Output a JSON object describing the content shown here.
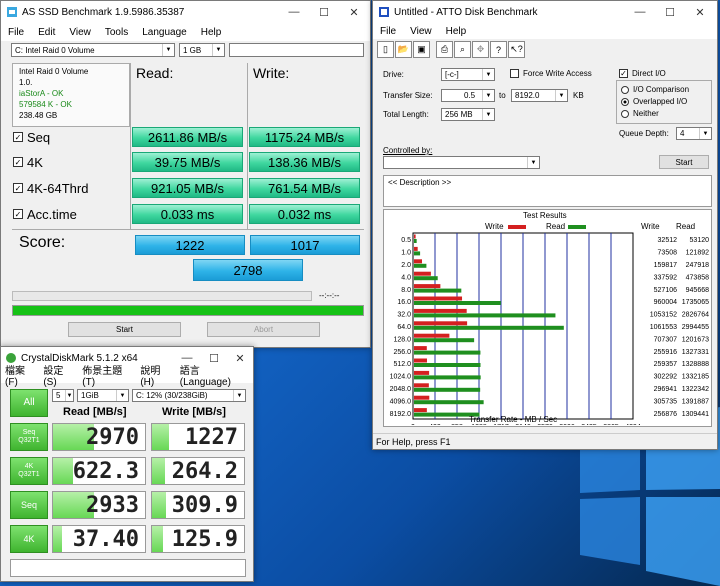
{
  "asssd": {
    "title": "AS SSD Benchmark 1.9.5986.35387",
    "menu": [
      "File",
      "Edit",
      "View",
      "Tools",
      "Language",
      "Help"
    ],
    "drive": "C: Intel Raid 0 Volume",
    "size": "1 GB",
    "info": {
      "name": "Intel Raid 0 Volume",
      "ver": "1.0.",
      "driver": "iaStorA - OK",
      "align": "579584 K - OK",
      "cap": "238.48 GB"
    },
    "read_hdr": "Read:",
    "write_hdr": "Write:",
    "rows": [
      {
        "label": "Seq",
        "read": "2611.86 MB/s",
        "write": "1175.24 MB/s"
      },
      {
        "label": "4K",
        "read": "39.75 MB/s",
        "write": "138.36 MB/s"
      },
      {
        "label": "4K-64Thrd",
        "read": "921.05 MB/s",
        "write": "761.54 MB/s"
      },
      {
        "label": "Acc.time",
        "read": "0.033 ms",
        "write": "0.032 ms"
      }
    ],
    "score_label": "Score:",
    "score_read": "1222",
    "score_write": "1017",
    "score_total": "2798",
    "time": "--:--:--",
    "start": "Start",
    "abort": "Abort",
    "progress": 1.0
  },
  "atto": {
    "title": "Untitled - ATTO Disk Benchmark",
    "menu": [
      "File",
      "View",
      "Help"
    ],
    "drive_label": "Drive:",
    "drive": "[-c-]",
    "force_write": "Force Write Access",
    "direct_io": "Direct I/O",
    "transfer_label": "Transfer Size:",
    "ts_from": "0.5",
    "ts_to_label": "to",
    "ts_to": "8192.0",
    "ts_unit": "KB",
    "total_label": "Total Length:",
    "total": "256 MB",
    "io_comparison": "I/O Comparison",
    "overlapped": "Overlapped I/O",
    "neither": "Neither",
    "queue_label": "Queue Depth:",
    "queue": "4",
    "controlled_label": "Controlled by:",
    "start": "Start",
    "description": "<< Description >>",
    "status": "For Help, press F1",
    "toolbar_icons": [
      "new-icon",
      "open-icon",
      "save-icon",
      "print-icon",
      "print-preview-icon",
      "move-icon",
      "help-icon",
      "context-help-icon"
    ]
  },
  "chart_data": {
    "type": "bar",
    "title": "Test Results",
    "legend": [
      "Write",
      "Read"
    ],
    "xlabel": "Transfer Rate - MB / Sec",
    "xticks": [
      "0",
      "429",
      "858",
      "1288",
      "1717",
      "2146",
      "2576",
      "3006",
      "3435",
      "3865",
      "4294"
    ],
    "xlim": [
      0,
      4294
    ],
    "categories": [
      "0.5",
      "1.0",
      "2.0",
      "4.0",
      "8.0",
      "16.0",
      "32.0",
      "64.0",
      "128.0",
      "256.0",
      "512.0",
      "1024.0",
      "2048.0",
      "4096.0",
      "8192.0"
    ],
    "col_write": "Write",
    "col_read": "Read",
    "series": [
      {
        "name": "Write",
        "color": "#d42020",
        "values": [
          32512,
          73508,
          159817,
          337592,
          527106,
          960004,
          1053152,
          1061553,
          707307,
          255916,
          259357,
          302292,
          296941,
          305735,
          256876
        ]
      },
      {
        "name": "Read",
        "color": "#1f8f1f",
        "values": [
          53120,
          121892,
          247918,
          473858,
          945668,
          1735065,
          2826764,
          2994455,
          1201673,
          1327331,
          1328888,
          1332185,
          1322342,
          1391887,
          1309441
        ]
      }
    ]
  },
  "cdm": {
    "title": "CrystalDiskMark 5.1.2 x64",
    "menu": [
      "檔案(F)",
      "設定(S)",
      "佈景主題(T)",
      "說明(H)",
      "語言(Language)"
    ],
    "all": "All",
    "count": "5",
    "size": "1GiB",
    "drive": "C: 12% (30/238GiB)",
    "read_hdr": "Read [MB/s]",
    "write_hdr": "Write [MB/s]",
    "rows": [
      {
        "l1": "Seq",
        "l2": "Q32T1",
        "read": "2970",
        "write": "1227",
        "rf": 0.45,
        "wf": 0.19
      },
      {
        "l1": "4K",
        "l2": "Q32T1",
        "read": "622.3",
        "write": "264.2",
        "rf": 0.22,
        "wf": 0.14
      },
      {
        "l1": "Seq",
        "l2": "",
        "read": "2933",
        "write": "309.9",
        "rf": 0.45,
        "wf": 0.15
      },
      {
        "l1": "4K",
        "l2": "",
        "read": "37.40",
        "write": "125.9",
        "rf": 0.1,
        "wf": 0.12
      }
    ]
  }
}
